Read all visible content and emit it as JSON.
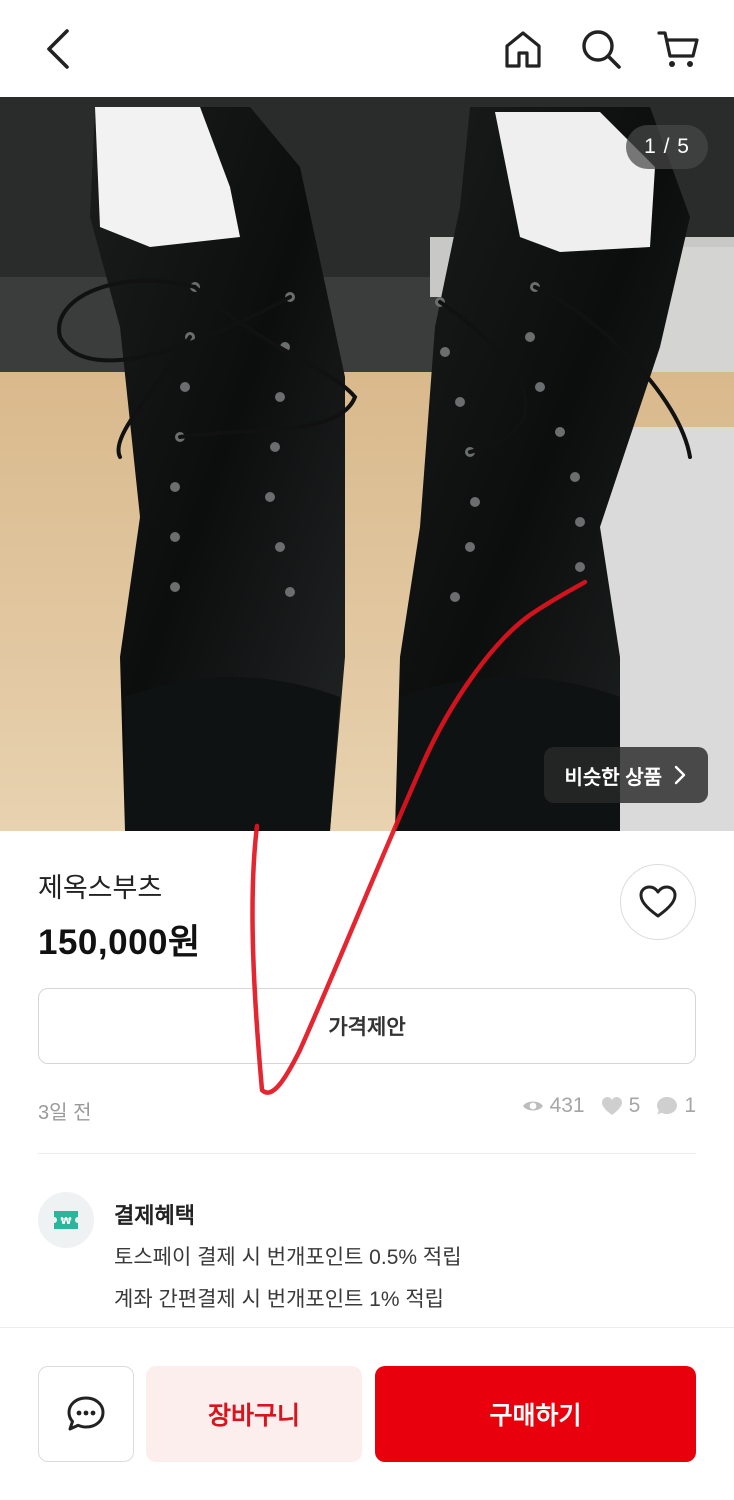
{
  "header": {
    "back_icon": "chevron-left-icon",
    "home_icon": "home-icon",
    "search_icon": "search-icon",
    "cart_icon": "cart-icon"
  },
  "gallery": {
    "counter": "1 / 5",
    "similar_label": "비슷한 상품",
    "similar_icon": "chevron-right-icon"
  },
  "product": {
    "title": "제옥스부츠",
    "price": "150,000원",
    "offer_label": "가격제안",
    "posted": "3일 전",
    "views": "431",
    "likes": "5",
    "comments": "1"
  },
  "benefit": {
    "title": "결제혜택",
    "line1": "토스페이 결제 시 번개포인트 0.5% 적립",
    "line2": "계좌 간편결제 시 번개포인트 1% 적립"
  },
  "actions": {
    "cart_label": "장바구니",
    "buy_label": "구매하기"
  },
  "colors": {
    "accent": "#e8000c",
    "cart_bg": "#fdeeee",
    "cart_text": "#d8141c"
  }
}
